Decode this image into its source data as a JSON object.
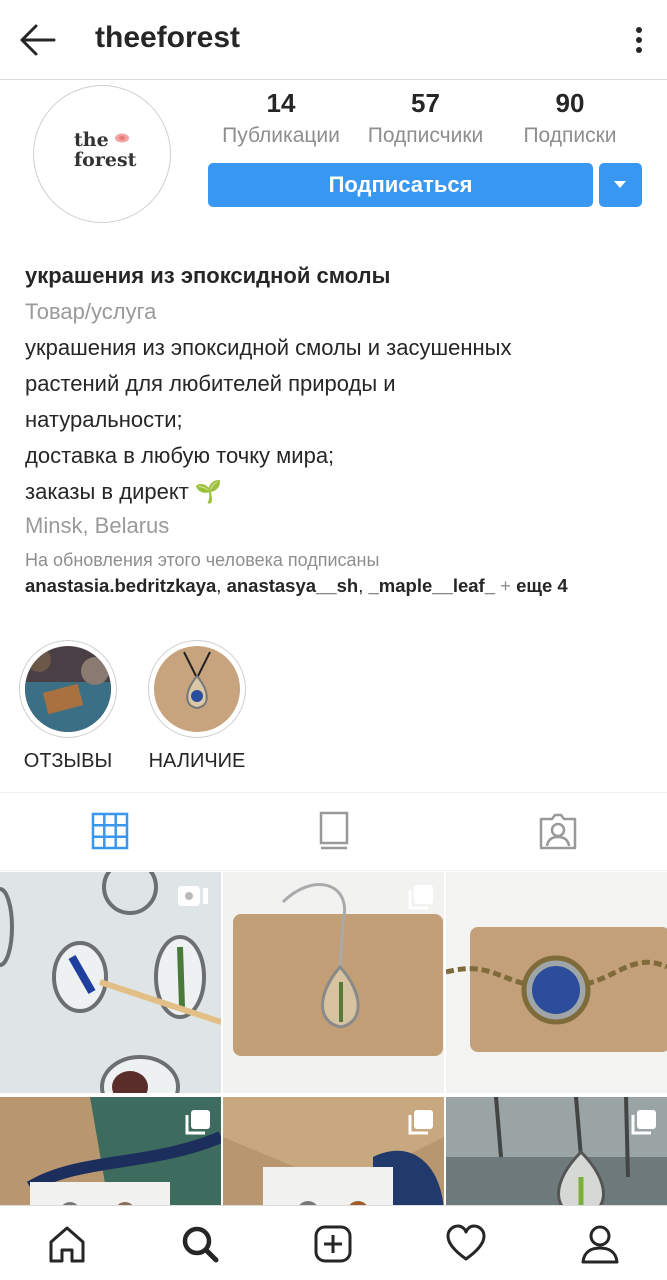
{
  "header": {
    "username": "theeforest",
    "back_icon": "arrow-left-icon",
    "more_icon": "more-vertical-icon"
  },
  "avatar": {
    "logo_line1": "the",
    "logo_line2": "forest"
  },
  "stats": [
    {
      "value": "14",
      "label": "Публикации"
    },
    {
      "value": "57",
      "label": "Подписчики"
    },
    {
      "value": "90",
      "label": "Подписки"
    }
  ],
  "actions": {
    "follow_label": "Подписаться",
    "accent_color": "#3897f0"
  },
  "bio": {
    "name": "украшения из эпоксидной смолы",
    "category": "Товар/услуга",
    "lines": [
      "украшения из эпоксидной смолы и засушенных",
      "растений для любителей природы и",
      "натуральности;",
      "доставка в любую точку мира;",
      "заказы в директ 🌱"
    ],
    "location": "Minsk, Belarus",
    "followed_by_label": "На обновления этого человека подписаны",
    "followed_by": [
      "anastasia.bedritzkaya",
      "anastasya__sh",
      "_maple__leaf_"
    ],
    "followed_more": "+ еще 4"
  },
  "highlights": [
    {
      "label": "ОТЗЫВЫ"
    },
    {
      "label": "НАЛИЧИЕ"
    }
  ],
  "tabs": [
    {
      "name": "grid",
      "icon": "grid-icon",
      "active": true
    },
    {
      "name": "feed",
      "icon": "feed-icon",
      "active": false
    },
    {
      "name": "tagged",
      "icon": "tagged-person-icon",
      "active": false
    }
  ],
  "bottom_nav": [
    {
      "icon": "home-icon"
    },
    {
      "icon": "search-icon"
    },
    {
      "icon": "add-post-icon"
    },
    {
      "icon": "heart-icon"
    },
    {
      "icon": "profile-icon"
    }
  ]
}
